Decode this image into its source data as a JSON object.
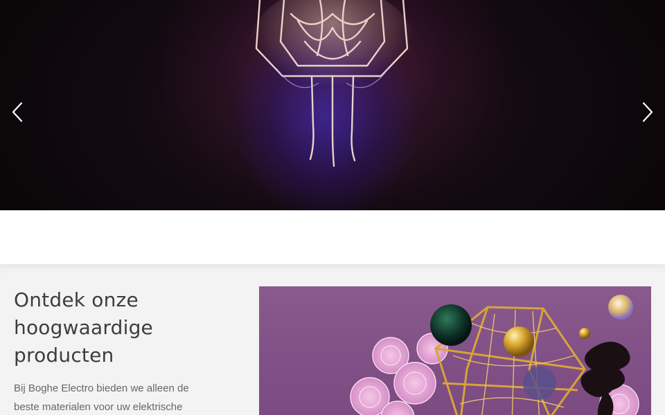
{
  "hero": {
    "prev_icon": "chevron-left-icon",
    "next_icon": "chevron-right-icon"
  },
  "products": {
    "title": "Ontdek onze hoogwaardige producten",
    "text": "Bij Boghe Electro bieden we alleen de beste materialen voor uw elektrische"
  },
  "colors": {
    "hero_bg": "#140a12",
    "section_bg": "#f3f3f3",
    "title_color": "#3d3d3d",
    "text_color": "#666666",
    "image_bg": "#8a5a8e"
  }
}
